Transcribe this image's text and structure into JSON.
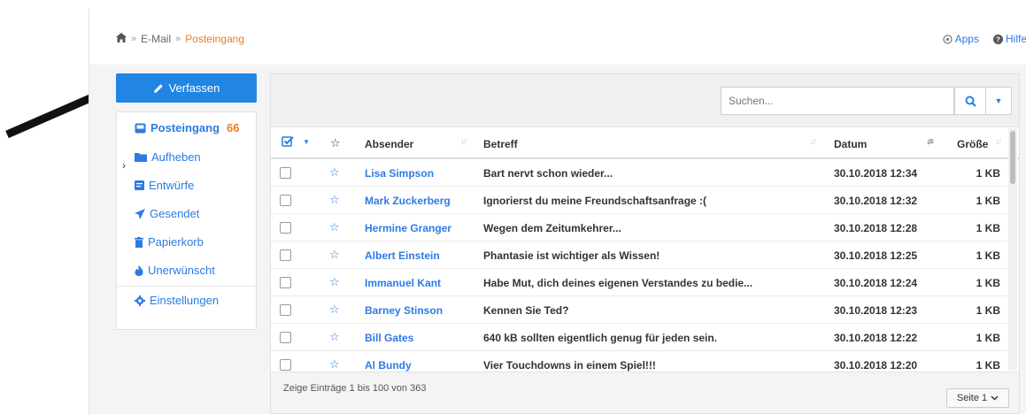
{
  "breadcrumb": {
    "home_icon": "home-icon",
    "separator": "»",
    "items": [
      "E-Mail",
      "Posteingang"
    ]
  },
  "top_links": {
    "apps": "Apps",
    "help": "Hilfe"
  },
  "compose": {
    "label": "Verfassen",
    "icon": "pencil-icon"
  },
  "folders": [
    {
      "label": "Posteingang",
      "count": "66",
      "icon": "inbox-icon",
      "active": true
    },
    {
      "label": "Aufheben",
      "icon": "folder-icon"
    },
    {
      "label": "Entwürfe",
      "icon": "draft-icon"
    },
    {
      "label": "Gesendet",
      "icon": "send-icon"
    },
    {
      "label": "Papierkorb",
      "icon": "trash-icon"
    },
    {
      "label": "Unerwünscht",
      "icon": "fire-icon"
    },
    {
      "label": "Einstellungen",
      "icon": "gear-icon"
    }
  ],
  "search": {
    "placeholder": "Suchen..."
  },
  "table": {
    "headers": {
      "sender": "Absender",
      "subject": "Betreff",
      "date": "Datum",
      "size": "Größe"
    },
    "rows": [
      {
        "sender": "Lisa Simpson",
        "subject": "Bart nervt schon wieder...",
        "date": "30.10.2018 12:34",
        "size": "1 KB"
      },
      {
        "sender": "Mark Zuckerberg",
        "subject": "Ignorierst du meine Freundschaftsanfrage :(",
        "date": "30.10.2018 12:32",
        "size": "1 KB"
      },
      {
        "sender": "Hermine Granger",
        "subject": "Wegen dem Zeitumkehrer...",
        "date": "30.10.2018 12:28",
        "size": "1 KB"
      },
      {
        "sender": "Albert Einstein",
        "subject": "Phantasie ist wichtiger als Wissen!",
        "date": "30.10.2018 12:25",
        "size": "1 KB"
      },
      {
        "sender": "Immanuel Kant",
        "subject": "Habe Mut, dich deines eigenen Verstandes zu bedie...",
        "date": "30.10.2018 12:24",
        "size": "1 KB"
      },
      {
        "sender": "Barney Stinson",
        "subject": "Kennen Sie Ted?",
        "date": "30.10.2018 12:23",
        "size": "1 KB"
      },
      {
        "sender": "Bill Gates",
        "subject": "640 kB sollten eigentlich genug für jeden sein.",
        "date": "30.10.2018 12:22",
        "size": "1 KB"
      },
      {
        "sender": "Al Bundy",
        "subject": "Vier Touchdowns in einem Spiel!!!",
        "date": "30.10.2018 12:20",
        "size": "1 KB"
      }
    ]
  },
  "footer": {
    "entries_text": "Zeige Einträge 1 bis 100 von 363",
    "page_label": "Seite 1"
  },
  "colors": {
    "accent": "#2185e5",
    "highlight": "#e67e22"
  }
}
